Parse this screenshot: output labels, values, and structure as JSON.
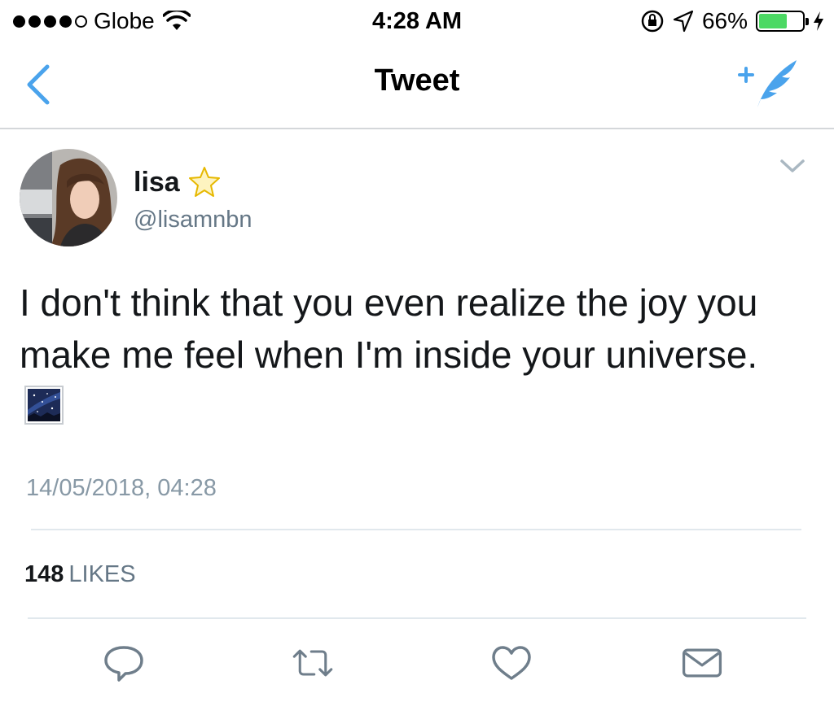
{
  "status_bar": {
    "carrier": "Globe",
    "time": "4:28 AM",
    "battery_percent": "66%",
    "battery_level": 0.66,
    "signal_bars_filled": 4,
    "signal_bars_total": 5
  },
  "nav": {
    "title": "Tweet",
    "back_icon": "chevron-left-icon",
    "compose_icon": "compose-quill-icon"
  },
  "tweet": {
    "name": "lisa",
    "name_emoji": "star-emoji",
    "handle": "@lisamnbn",
    "text": "I don't think that you even realize the joy you make me feel when I'm inside your universe.",
    "text_emoji": "milky-way-emoji",
    "timestamp": "14/05/2018, 04:28",
    "likes_count": "148",
    "likes_label": "LIKES"
  },
  "actions": [
    "reply-icon",
    "retweet-icon",
    "like-icon",
    "direct-message-icon"
  ],
  "colors": {
    "accent": "#4aa3ec",
    "secondary_text": "#657786",
    "timestamp": "#8899a6",
    "icon_gray": "#6f7e8b",
    "battery": "#4cd964"
  }
}
